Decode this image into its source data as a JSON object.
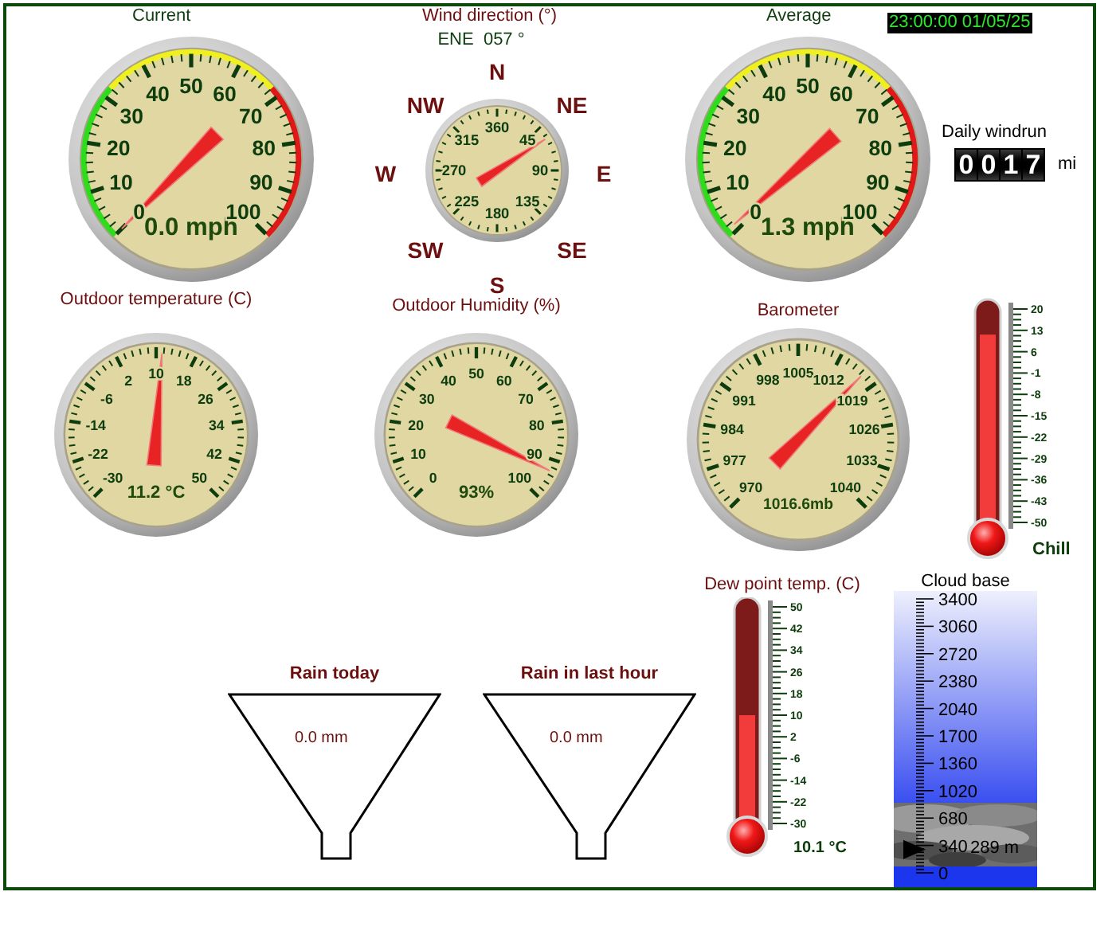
{
  "timestamp": "23:00:00 01/05/25",
  "wind_speed": [
    {
      "title": "Current",
      "kind": "speed",
      "labels": [
        [
          "50"
        ],
        [
          "40",
          "60"
        ],
        [
          "30",
          "70"
        ],
        [
          "20",
          "80"
        ],
        [
          "10",
          "90"
        ],
        [
          "0",
          "100"
        ]
      ],
      "reading": "0.0 mph"
    },
    {
      "title": "Average",
      "kind": "speed",
      "labels": [
        [
          "50"
        ],
        [
          "40",
          "60"
        ],
        [
          "30",
          "70"
        ],
        [
          "20",
          "80"
        ],
        [
          "10",
          "90"
        ],
        [
          "0",
          "100"
        ]
      ],
      "reading": "1.3 mph"
    }
  ],
  "wind_direction": {
    "title": "Wind direction (°)",
    "reading": "ENE  057 °",
    "points": [
      "N",
      "NE",
      "E",
      "SE",
      "S",
      "SW",
      "W",
      "NW"
    ],
    "labels": [
      "360",
      "45",
      "90",
      "135",
      "180",
      "225",
      "270",
      "315"
    ]
  },
  "windrun": {
    "label": "Daily windrun",
    "digits": [
      "0",
      "0",
      "1",
      "7"
    ],
    "unit": "mi"
  },
  "temperature": {
    "title": "Outdoor temperature (C)",
    "labels": [
      [
        "10"
      ],
      [
        "2",
        "18"
      ],
      [
        "-6",
        "26"
      ],
      [
        "-14",
        "34"
      ],
      [
        "-22",
        "42"
      ],
      [
        "-30",
        "50"
      ]
    ],
    "reading": "11.2 °C"
  },
  "humidity": {
    "title": "Outdoor Humidity (%)",
    "labels": [
      [
        "50"
      ],
      [
        "40",
        "60"
      ],
      [
        "30",
        "70"
      ],
      [
        "20",
        "80"
      ],
      [
        "10",
        "90"
      ],
      [
        "0",
        "100"
      ]
    ],
    "reading": "93%"
  },
  "barometer": {
    "title": "Barometer",
    "labels": [
      [
        "1005"
      ],
      [
        "998",
        "1012"
      ],
      [
        "991",
        "1019"
      ],
      [
        "984",
        "1026"
      ],
      [
        "977",
        "1033"
      ],
      [
        "970",
        "1040"
      ]
    ],
    "reading": "1016.6mb"
  },
  "wind_chill": {
    "labels": [
      "20",
      "13",
      "6",
      "-1",
      "-8",
      "-15",
      "-22",
      "-29",
      "-36",
      "-43",
      "-50"
    ],
    "level": 0.88,
    "reading": "Chill"
  },
  "rain": [
    {
      "title": "Rain today",
      "reading": "0.0 mm"
    },
    {
      "title": "Rain in last hour",
      "reading": "0.0 mm"
    }
  ],
  "dew_point": {
    "title": "Dew point temp. (C)",
    "labels": [
      "50",
      "42",
      "34",
      "26",
      "18",
      "10",
      "2",
      "-6",
      "-14",
      "-22",
      "-30"
    ],
    "level": 0.5,
    "reading": "10.1 °C"
  },
  "cloud_base": {
    "title": "Cloud base",
    "labels": [
      "3400",
      "3060",
      "2720",
      "2380",
      "2040",
      "1700",
      "1360",
      "1020",
      "680",
      "340",
      "0"
    ],
    "level": 0.085,
    "reading": "289 m"
  }
}
